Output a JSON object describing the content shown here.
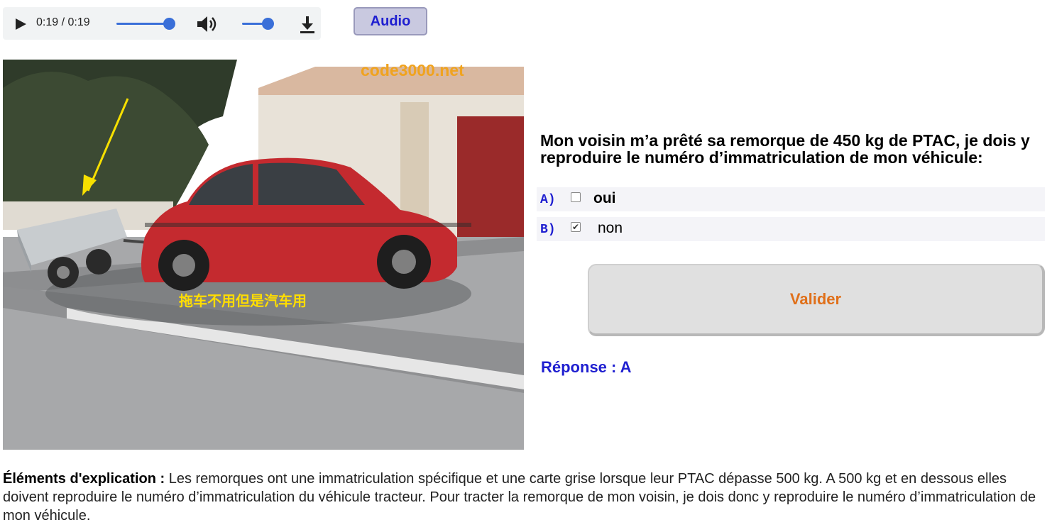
{
  "player": {
    "time": "0:19 / 0:19",
    "progress": 1.0,
    "volume": 1.0,
    "icons": [
      "play-icon",
      "volume-icon",
      "download-icon"
    ]
  },
  "audio_button": {
    "label": "Audio"
  },
  "image": {
    "watermark": "code3000.net",
    "caption": "拖车不用但是汽车用"
  },
  "question": {
    "text": "Mon voisin m’a prêté sa remorque de 450 kg de PTAC, je dois y reproduire le numéro d’immatriculation de mon véhicule:",
    "choices": [
      {
        "letter": "A)",
        "label": "oui",
        "checked": false
      },
      {
        "letter": "B)",
        "label": "non",
        "checked": true
      }
    ]
  },
  "submit": {
    "label": "Valider"
  },
  "answer": {
    "text": "Réponse : A"
  },
  "explanation": {
    "heading": "Éléments d'explication :",
    "body": "Les remorques ont une immatriculation spécifique et une carte grise lorsque leur PTAC dépasse 500 kg. A 500 kg et en dessous elles doivent reproduire le numéro d’immatriculation du véhicule tracteur. Pour tracter la remorque de mon voisin, je dois donc y reproduire le numéro d’immatriculation de mon véhicule."
  },
  "colors": {
    "accent_blue": "#1f1fd0",
    "submit_text": "#e0701a",
    "watermark": "#f0a31f",
    "caption": "#ffdd00",
    "slider": "#3a6fd8"
  }
}
